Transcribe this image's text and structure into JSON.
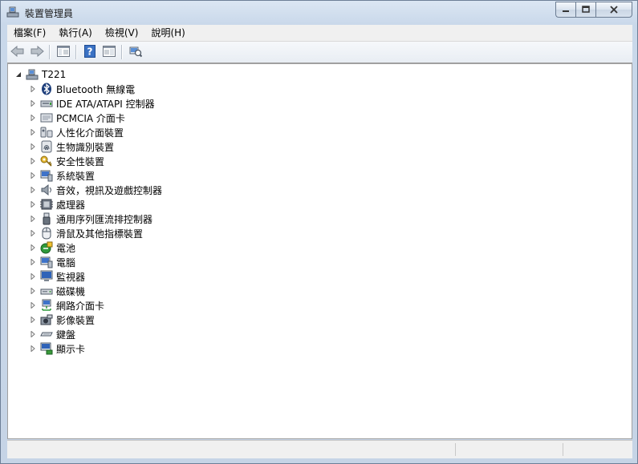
{
  "window": {
    "title": "裝置管理員"
  },
  "menu": [
    "檔案(F)",
    "執行(A)",
    "檢視(V)",
    "說明(H)"
  ],
  "toolbar": [
    "back-arrow-icon",
    "forward-arrow-icon",
    "show-hide-console-tree-icon",
    "help-icon",
    "properties-pane-icon",
    "scan-hardware-icon"
  ],
  "tree": {
    "root": "T221",
    "items": [
      {
        "label": "Bluetooth 無線電",
        "icon": "bluetooth-icon"
      },
      {
        "label": "IDE ATA/ATAPI 控制器",
        "icon": "ide-controller-icon"
      },
      {
        "label": "PCMCIA 介面卡",
        "icon": "pcmcia-icon"
      },
      {
        "label": "人性化介面裝置",
        "icon": "hid-icon"
      },
      {
        "label": "生物識別裝置",
        "icon": "fingerprint-icon"
      },
      {
        "label": "安全性裝置",
        "icon": "key-icon"
      },
      {
        "label": "系統裝置",
        "icon": "system-device-icon"
      },
      {
        "label": "音效，視訊及遊戲控制器",
        "icon": "speaker-icon"
      },
      {
        "label": "處理器",
        "icon": "processor-icon"
      },
      {
        "label": "通用序列匯流排控制器",
        "icon": "usb-icon"
      },
      {
        "label": "滑鼠及其他指標裝置",
        "icon": "mouse-icon"
      },
      {
        "label": "電池",
        "icon": "battery-icon"
      },
      {
        "label": "電腦",
        "icon": "computer-icon"
      },
      {
        "label": "監視器",
        "icon": "monitor-icon"
      },
      {
        "label": "磁碟機",
        "icon": "disk-drive-icon"
      },
      {
        "label": "網路介面卡",
        "icon": "network-adapter-icon"
      },
      {
        "label": "影像裝置",
        "icon": "imaging-device-icon"
      },
      {
        "label": "鍵盤",
        "icon": "keyboard-icon"
      },
      {
        "label": "顯示卡",
        "icon": "display-adapter-icon"
      }
    ]
  },
  "colors": {
    "accent": "#3b72c4",
    "window_frame": "#c6d4e6"
  }
}
